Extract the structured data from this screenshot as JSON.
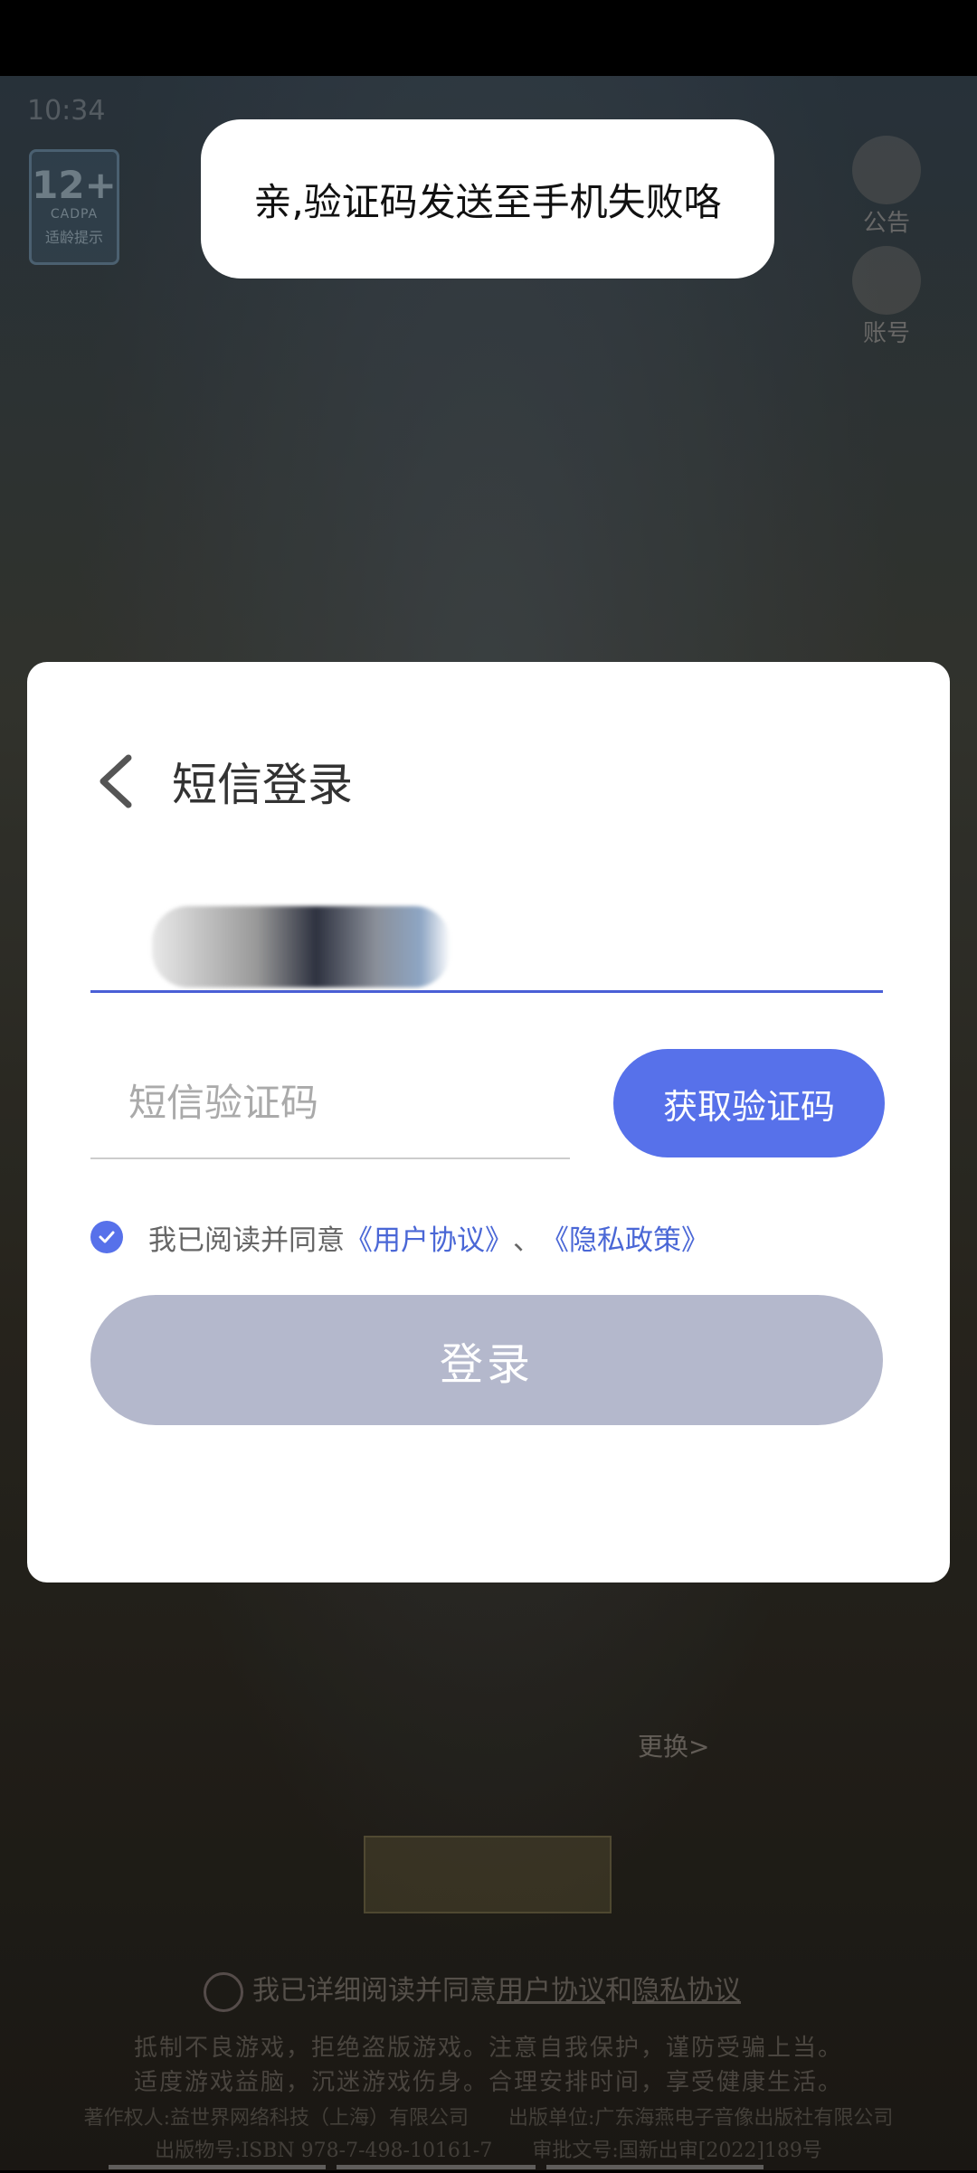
{
  "background": {
    "status_time": "10:34",
    "age_badge": {
      "age": "12+",
      "org": "CADPA",
      "hint": "适龄提示"
    },
    "side_buttons": {
      "notice": "公告",
      "account": "账号"
    },
    "change_label": "更换>",
    "agree_text": "我已详细阅读并同意",
    "agree_link1": "用户协议",
    "agree_and": "和",
    "agree_link2": "隐私协议",
    "notice_line1": "抵制不良游戏，拒绝盗版游戏。注意自我保护，谨防受骗上当。",
    "notice_line2": "适度游戏益脑，沉迷游戏伤身。合理安排时间，享受健康生活。",
    "credit_line1": "著作权人:益世界网络科技（上海）有限公司　　出版单位:广东海燕电子音像出版社有限公司",
    "credit_line2": "出版物号:ISBN 978-7-498-10161-7　　审批文号:国新出审[2022]189号"
  },
  "toast": {
    "message": "亲,验证码发送至手机失败咯"
  },
  "dialog": {
    "title": "短信登录",
    "code_placeholder": "短信验证码",
    "get_code_label": "获取验证码",
    "agree_prefix": "我已阅读并同意",
    "user_agreement": "《用户协议》",
    "separator": "、",
    "privacy_policy": "《隐私政策》",
    "login_label": "登录"
  },
  "colors": {
    "accent": "#5771ea",
    "link": "#4a67d6",
    "login_disabled": "#b4b8cc",
    "underline_active": "#4a5fd6"
  }
}
